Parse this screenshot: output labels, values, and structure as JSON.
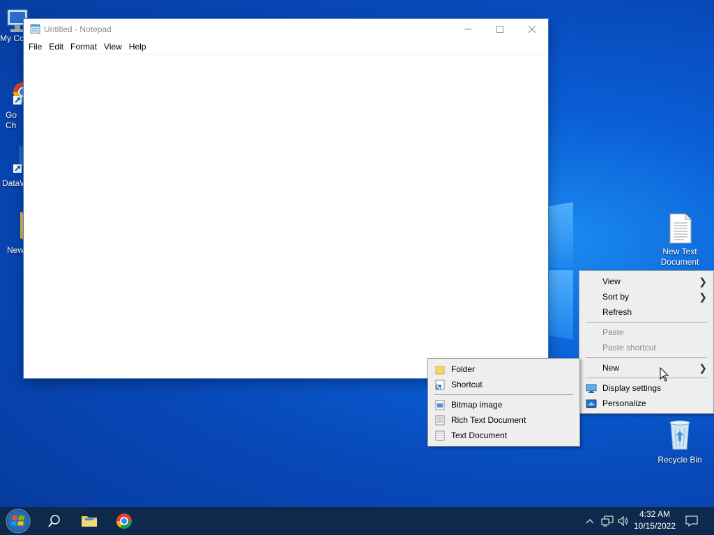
{
  "desktop": {
    "left_icons": [
      {
        "label": "My Co",
        "icon": "computer-icon"
      },
      {
        "label": "Go\nCh",
        "icon": "chrome-shortcut-icon"
      },
      {
        "label": "DataW",
        "icon": "app-shortcut-icon"
      },
      {
        "label": "New",
        "icon": "folder-icon"
      }
    ],
    "right_icons": [
      {
        "label": "New Text\nDocument",
        "icon": "text-document-icon"
      },
      {
        "label": "Recycle Bin",
        "icon": "recycle-bin-icon"
      }
    ]
  },
  "notepad": {
    "title": "Untitled - Notepad",
    "menu": [
      "File",
      "Edit",
      "Format",
      "View",
      "Help"
    ],
    "content": ""
  },
  "context_menu": {
    "items": [
      {
        "label": "View",
        "submenu": true,
        "disabled": false
      },
      {
        "label": "Sort by",
        "submenu": true,
        "disabled": false
      },
      {
        "label": "Refresh",
        "submenu": false,
        "disabled": false
      },
      {
        "label": "Paste",
        "submenu": false,
        "disabled": true
      },
      {
        "label": "Paste shortcut",
        "submenu": false,
        "disabled": true
      },
      {
        "label": "New",
        "submenu": true,
        "disabled": false
      },
      {
        "label": "Display settings",
        "icon": "display-icon"
      },
      {
        "label": "Personalize",
        "icon": "personalize-icon"
      }
    ]
  },
  "new_submenu": {
    "items": [
      {
        "label": "Folder",
        "icon": "folder-icon"
      },
      {
        "label": "Shortcut",
        "icon": "shortcut-icon"
      },
      {
        "label": "Bitmap image",
        "icon": "bitmap-icon"
      },
      {
        "label": "Rich Text Document",
        "icon": "rich-text-icon"
      },
      {
        "label": "Text Document",
        "icon": "text-document-icon"
      }
    ]
  },
  "taskbar": {
    "buttons": [
      "start-button",
      "search-button",
      "file-explorer-button",
      "chrome-button"
    ],
    "tray": [
      "show-hidden-icons",
      "network-icon",
      "volume-icon"
    ],
    "time": "4:32 AM",
    "date": "10/15/2022"
  },
  "colors": {
    "taskbar": "#0d2a4d",
    "menu_bg": "#eeeeee",
    "wallpaper": "#0a5ed6"
  }
}
